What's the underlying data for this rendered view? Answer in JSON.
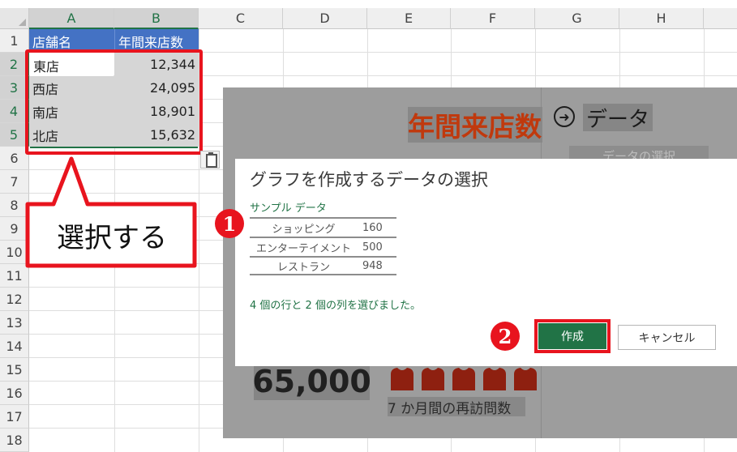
{
  "sheet": {
    "columns": [
      "A",
      "B",
      "C",
      "D",
      "E",
      "F",
      "G",
      "H"
    ],
    "rows": [
      "1",
      "2",
      "3",
      "4",
      "5",
      "6",
      "7",
      "8",
      "9",
      "10",
      "11",
      "12",
      "13",
      "14",
      "15",
      "16",
      "17",
      "18"
    ],
    "header": {
      "a1": "店舗名",
      "b1": "年間来店数"
    },
    "data": [
      {
        "store": "東店",
        "visits": "12,344"
      },
      {
        "store": "西店",
        "visits": "24,095"
      },
      {
        "store": "南店",
        "visits": "18,901"
      },
      {
        "store": "北店",
        "visits": "15,632"
      }
    ]
  },
  "callout": {
    "text": "選択する"
  },
  "background_panel": {
    "title": "年間来店数",
    "data_link": "データ",
    "select_data_button": "データの選択",
    "big_number": "65,000",
    "caption": "7 か月間の再訪問数"
  },
  "dialog": {
    "title": "グラフを作成するデータの選択",
    "sample_label": "サンプル データ",
    "sample_rows": [
      {
        "label": "ショッピング",
        "value": "160"
      },
      {
        "label": "エンターテイメント",
        "value": "500"
      },
      {
        "label": "レストラン",
        "value": "948"
      }
    ],
    "status": "4 個の行と 2 個の列を選びました。",
    "create_button": "作成",
    "cancel_button": "キャンセル"
  },
  "steps": {
    "one": "1",
    "two": "2"
  },
  "colors": {
    "accent_red": "#e8141e",
    "excel_green": "#217346",
    "header_blue": "#4472c4",
    "title_orange": "#c0390d"
  }
}
